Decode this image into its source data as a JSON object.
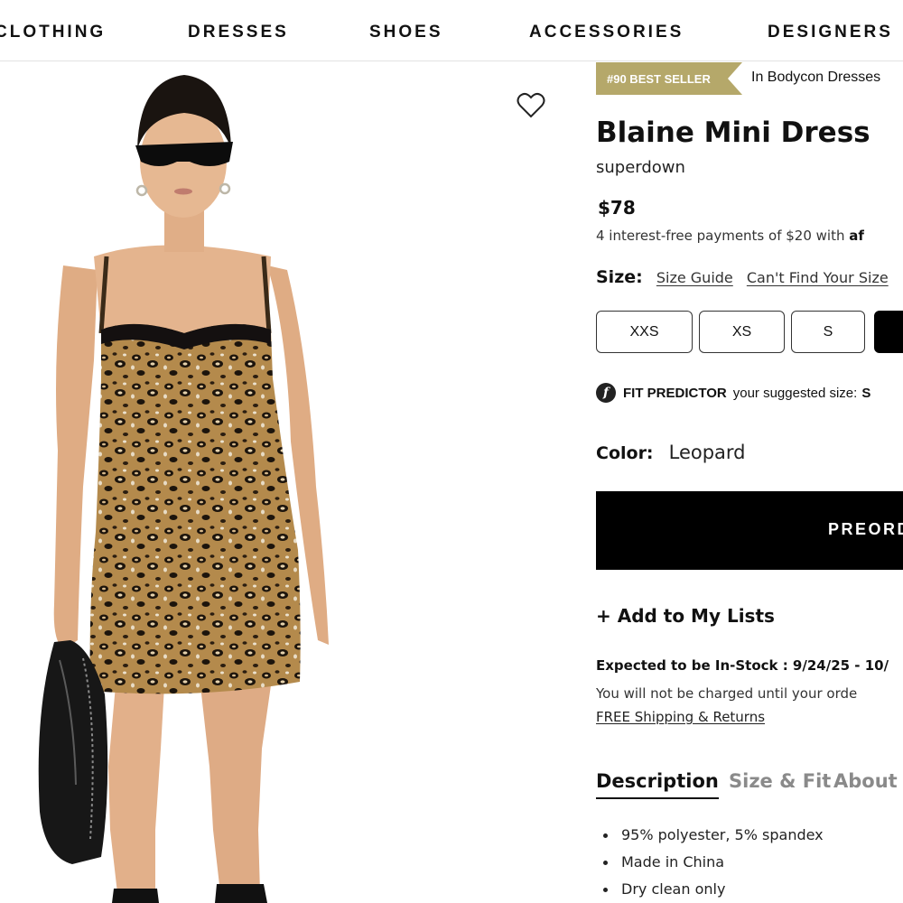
{
  "nav": {
    "items": [
      "CLOTHING",
      "DRESSES",
      "SHOES",
      "ACCESSORIES",
      "DESIGNERS"
    ]
  },
  "product": {
    "badge": "#90 BEST SELLER",
    "badge_category": "In Bodycon Dresses",
    "title": "Blaine Mini Dress",
    "brand": "superdown",
    "price": "$78",
    "payments_text": "4 interest-free payments of $20 with",
    "payments_provider": "af",
    "size_label": "Size:",
    "size_guide": "Size Guide",
    "cant_find": "Can't Find Your Size",
    "sizes": [
      "XXS",
      "XS",
      "S",
      ""
    ],
    "fit_predictor_label": "FIT PREDICTOR",
    "fit_predictor_text": "your suggested size:",
    "fit_predictor_size": "S",
    "color_label": "Color:",
    "color_value": "Leopard",
    "preorder_label": "PREORD",
    "add_to_lists": "+ Add to My Lists",
    "stock_text": "Expected to be In-Stock : 9/24/25 - 10/",
    "charged_text": "You will not be charged until your orde",
    "shipping_text": "FREE Shipping & Returns"
  },
  "tabs": [
    "Description",
    "Size & Fit",
    "About T"
  ],
  "description": [
    "95% polyester, 5% spandex",
    "Made in China",
    "Dry clean only"
  ],
  "colors": {
    "badge_bg": "#b5a86a",
    "button_bg": "#000000",
    "tab_inactive": "#8a8a8a"
  },
  "icons": {
    "wishlist": "heart-outline-icon",
    "fit": "fit-predictor-icon"
  }
}
